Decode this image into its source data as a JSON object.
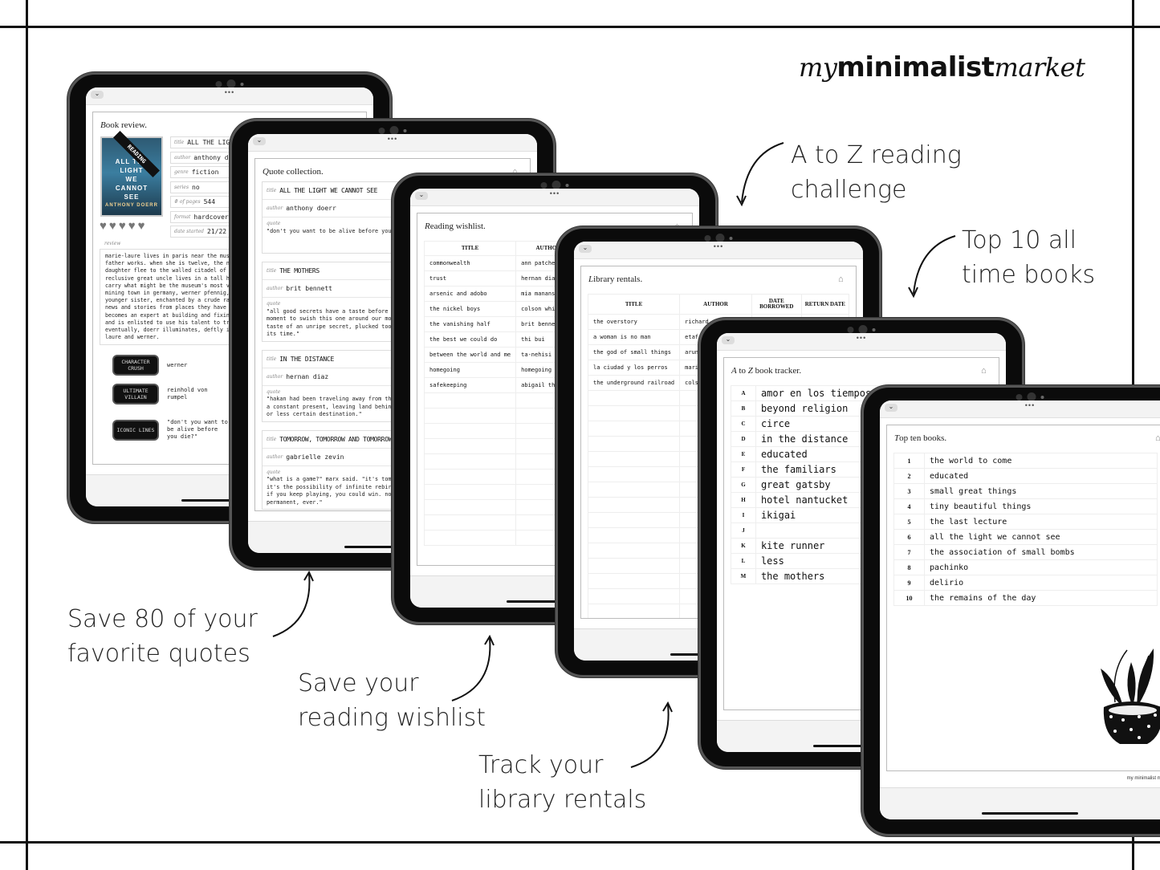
{
  "brand": {
    "prefix": "my",
    "bold": "minimalist",
    "suffix": "market"
  },
  "captions": {
    "quotes": "Save 80 of your\nfavorite quotes",
    "wishlist": "Save your\nreading wishlist",
    "library": "Track your\nlibrary rentals",
    "atoz": "A to Z reading\nchallenge",
    "top10": "Top 10 all\ntime books"
  },
  "ui": {
    "collapse_glyph": "⌄",
    "dots": "•••",
    "house_icon": "⌂"
  },
  "book_review": {
    "title_first": "B",
    "title_rest": "ook review.",
    "cover": {
      "lines": [
        "ALL THE",
        "LIGHT",
        "WE",
        "CANNOT",
        "SEE"
      ],
      "band": "READING",
      "author": "ANTHONY DOERR"
    },
    "rating": {
      "value": 5,
      "max": 5
    },
    "fields": [
      {
        "label": "title",
        "value": "ALL THE LIGHT WE CANNOT SEE"
      },
      {
        "label": "author",
        "value": "anthony doerr"
      },
      {
        "label": "genre",
        "value": "fiction"
      },
      {
        "label": "series",
        "value": "no"
      },
      {
        "label": "# of pages",
        "value": "544"
      },
      {
        "label": "format",
        "value": "hardcover"
      },
      {
        "label": "date started",
        "value": "21/22"
      }
    ],
    "review_label": "review",
    "review": "marie-laure lives in paris near the museum of natural history where her father works. when she is twelve, the nazis occupy paris and father and daughter flee to the walled citadel of saint-malo, where marie-laure's reclusive great uncle lives in a tall house by the sea. with them they carry what might be the museum's most valuable and dangerous jewel. in a mining town in germany, werner pfennig, an orphan, grows up with his younger sister, enchanted by a crude radio they find that brings them news and stories from places they have never seen or imagined. werner becomes an expert at building and fixing these crucial new instruments and is enlisted to use his talent to track down the resistance. eventually, doerr illuminates, deftly interweaving the lives of marie-laure and werner.",
    "badges": [
      {
        "label": "CHARACTER CRUSH",
        "value": "werner"
      },
      {
        "label": "ULTIMATE VILLAIN",
        "value": "reinhold von rumpel"
      },
      {
        "label": "ICONIC LINES",
        "value": "\"don't you want to be alive before you die?\""
      }
    ]
  },
  "quote_collection": {
    "title_first": "Q",
    "title_rest": "uote collection.",
    "labels": {
      "title": "title",
      "author": "author",
      "quote": "quote"
    },
    "entries": [
      {
        "title": "ALL THE LIGHT WE CANNOT SEE",
        "author": "anthony doerr",
        "quote": "\"don't you want to be alive before you die?\""
      },
      {
        "title": "THE MOTHERS",
        "author": "brit bennett",
        "quote": "\"all good secrets have a taste before you tell them, and if we'd taken a moment to swish this one around our mouths, we might have noticed the sour taste of an unripe secret, plucked too soon, stolen and passed around before its time.\""
      },
      {
        "title": "IN THE DISTANCE",
        "author": "hernan diaz",
        "quote": "\"hakan had been traveling away from the past for so long that he remained in a constant present, leaving land behind without ever heading toward a more or less certain destination.\""
      },
      {
        "title": "TOMORROW, TOMORROW AND TOMORROW",
        "author": "gabrielle zevin",
        "quote": "\"what is a game?\" marx said. \"it's tomorrow, and tomorrow, and tomorrow. it's the possibility of infinite rebirth, infinite redemption. the idea that if you keep playing, you could win. no loss is permanent, because nothing is permanent, ever.\""
      }
    ]
  },
  "wishlist": {
    "title_first": "R",
    "title_rest": "eading wishlist.",
    "columns": [
      "TITLE",
      "AUTHOR"
    ],
    "rows": [
      [
        "commonwealth",
        "ann patchett"
      ],
      [
        "trust",
        "hernan diaz"
      ],
      [
        "arsenic and adobo",
        "mia manansala"
      ],
      [
        "the nickel boys",
        "colson whitehead"
      ],
      [
        "the vanishing half",
        "brit bennett"
      ],
      [
        "the best we could do",
        "thi bui"
      ],
      [
        "between the world and me",
        "ta-nehisi coates"
      ],
      [
        "homegoing",
        "homegoing"
      ],
      [
        "safekeeping",
        "abigail thomas"
      ],
      [
        "",
        ""
      ],
      [
        "",
        ""
      ],
      [
        "",
        ""
      ],
      [
        "",
        ""
      ],
      [
        "",
        ""
      ],
      [
        "",
        ""
      ],
      [
        "",
        ""
      ],
      [
        "",
        ""
      ],
      [
        "",
        ""
      ],
      [
        "",
        ""
      ]
    ]
  },
  "library": {
    "title_first": "L",
    "title_rest": "ibrary rentals.",
    "columns": [
      "TITLE",
      "AUTHOR",
      "DATE BORROWED",
      "RETURN DATE"
    ],
    "rows": [
      [
        "the overstory",
        "richard powers",
        "",
        ""
      ],
      [
        "a woman is no man",
        "etaf rum",
        "",
        ""
      ],
      [
        "the god of small things",
        "arundhati roy",
        "",
        ""
      ],
      [
        "la ciudad y los perros",
        "mario vargas llosa",
        "",
        ""
      ],
      [
        "the underground railroad",
        "colson whitehead",
        "",
        ""
      ],
      [
        "",
        "",
        "",
        ""
      ],
      [
        "",
        "",
        "",
        ""
      ],
      [
        "",
        "",
        "",
        ""
      ],
      [
        "",
        "",
        "",
        ""
      ],
      [
        "",
        "",
        "",
        ""
      ],
      [
        "",
        "",
        "",
        ""
      ],
      [
        "",
        "",
        "",
        ""
      ],
      [
        "",
        "",
        "",
        ""
      ],
      [
        "",
        "",
        "",
        ""
      ],
      [
        "",
        "",
        "",
        ""
      ],
      [
        "",
        "",
        "",
        ""
      ],
      [
        "",
        "",
        "",
        ""
      ],
      [
        "",
        "",
        "",
        ""
      ],
      [
        "",
        "",
        "",
        ""
      ],
      [
        "",
        "",
        "",
        ""
      ]
    ]
  },
  "atoz": {
    "title_a": "A",
    "title_mid": " to ",
    "title_z": "Z",
    "title_rest": " book tracker.",
    "rows": [
      [
        "A",
        "amor en los tiempos del colera"
      ],
      [
        "B",
        "beyond religion"
      ],
      [
        "C",
        "circe"
      ],
      [
        "D",
        "in the distance"
      ],
      [
        "E",
        "educated"
      ],
      [
        "F",
        "the familiars"
      ],
      [
        "G",
        "great gatsby"
      ],
      [
        "H",
        "hotel nantucket"
      ],
      [
        "I",
        "ikigai"
      ],
      [
        "J",
        ""
      ],
      [
        "K",
        "kite runner"
      ],
      [
        "L",
        "less"
      ],
      [
        "M",
        "the mothers"
      ]
    ]
  },
  "top_ten": {
    "title_first": "T",
    "title_rest": "op ten books.",
    "rows": [
      [
        "1",
        "the world to come"
      ],
      [
        "2",
        "educated"
      ],
      [
        "3",
        "small great things"
      ],
      [
        "4",
        "tiny beautiful things"
      ],
      [
        "5",
        "the last lecture"
      ],
      [
        "6",
        "all the light we cannot see"
      ],
      [
        "7",
        "the association of small bombs"
      ],
      [
        "8",
        "pachinko"
      ],
      [
        "9",
        "delirio"
      ],
      [
        "10",
        "the remains of the day"
      ]
    ],
    "footer_brand": "my minimalist market"
  }
}
